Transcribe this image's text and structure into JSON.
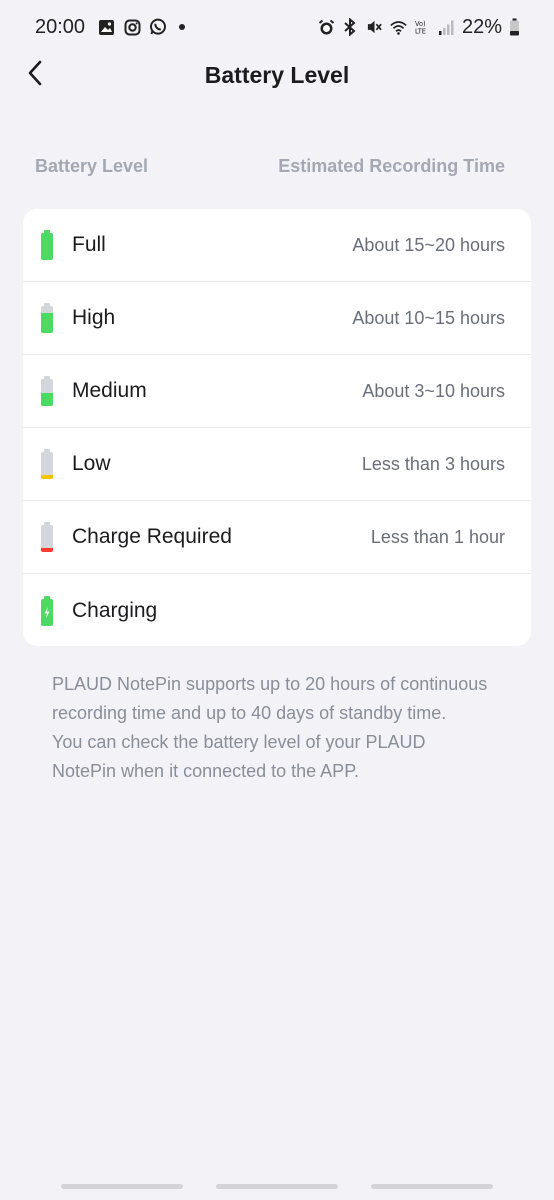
{
  "status_bar": {
    "time": "20:00",
    "battery_percent": "22%",
    "left_icons": [
      "gallery-icon",
      "instagram-icon",
      "whatsapp-icon"
    ],
    "right_icons": [
      "alarm-icon",
      "bluetooth-icon",
      "mute-icon",
      "wifi-icon",
      "volte-icon",
      "signal-icon",
      "battery-icon"
    ]
  },
  "header": {
    "title": "Battery Level",
    "back_icon": "chevron-left-icon"
  },
  "columns": {
    "level": "Battery Level",
    "time": "Estimated Recording Time"
  },
  "levels": [
    {
      "name": "Full",
      "time": "About 15~20 hours",
      "fill": 1.0,
      "color": "#4cd964"
    },
    {
      "name": "High",
      "time": "About 10~15 hours",
      "fill": 0.75,
      "color": "#4cd964"
    },
    {
      "name": "Medium",
      "time": "About 3~10 hours",
      "fill": 0.5,
      "color": "#4cd964"
    },
    {
      "name": "Low",
      "time": "Less than 3 hours",
      "fill": 0.15,
      "color": "#f5c400"
    },
    {
      "name": "Charge Required",
      "time": "Less than 1 hour",
      "fill": 0.15,
      "color": "#ff3b30"
    },
    {
      "name": "Charging",
      "time": "",
      "fill": 1.0,
      "color": "#4cd964",
      "charging": true
    }
  ],
  "note": {
    "line1": "PLAUD NotePin supports up to 20 hours of continuous recording time and up to 40 days of standby time.",
    "line2": "You can check the battery level of your PLAUD NotePin when it connected to the APP."
  }
}
